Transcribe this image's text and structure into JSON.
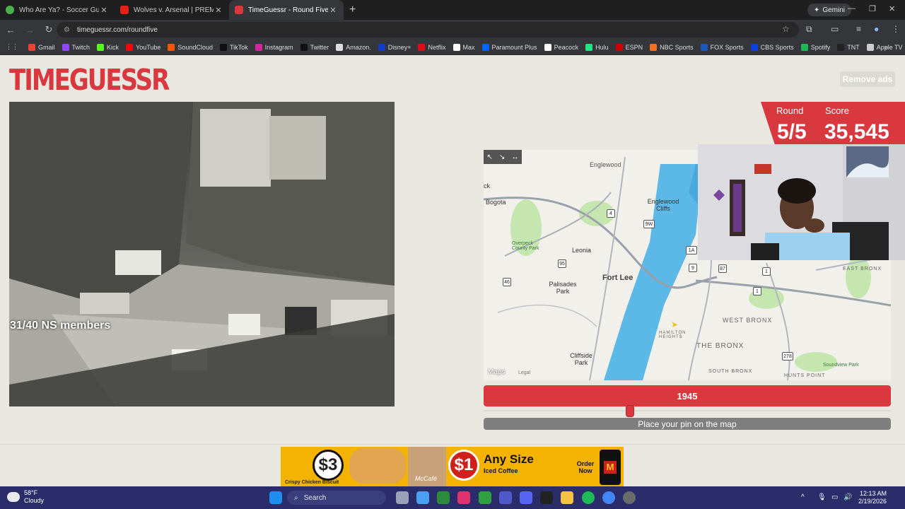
{
  "browser": {
    "tabs": [
      {
        "label": "Who Are Ya? - Soccer Guesser",
        "icon": "soccer-icon",
        "color": "#4caf50"
      },
      {
        "label": "Wolves v. Arsenal | PREMIER LE",
        "icon": "youtube-icon",
        "color": "#e62117"
      },
      {
        "label": "TimeGuessr - Round Five",
        "icon": "timeguessr-icon",
        "color": "#d9383f",
        "active": true
      }
    ],
    "new_tab": "+",
    "gemini_label": "Gemini",
    "url": "timeguessr.com/roundfive",
    "bookmarks": [
      {
        "label": "Gmail",
        "color": "#ea4335"
      },
      {
        "label": "Twitch",
        "color": "#9146ff"
      },
      {
        "label": "Kick",
        "color": "#53fc18"
      },
      {
        "label": "YouTube",
        "color": "#ff0000"
      },
      {
        "label": "SoundCloud",
        "color": "#ff5500"
      },
      {
        "label": "TikTok",
        "color": "#111111"
      },
      {
        "label": "Instagram",
        "color": "#d6249f"
      },
      {
        "label": "Twitter",
        "color": "#111111"
      },
      {
        "label": "Amazon.",
        "color": "#dddddd"
      },
      {
        "label": "Disney+",
        "color": "#113ccf"
      },
      {
        "label": "Netflix",
        "color": "#e50914"
      },
      {
        "label": "Max",
        "color": "#ffffff"
      },
      {
        "label": "Paramount Plus",
        "color": "#0064ff"
      },
      {
        "label": "Peacock",
        "color": "#ffffff"
      },
      {
        "label": "Hulu",
        "color": "#1ce783"
      },
      {
        "label": "ESPN",
        "color": "#d00000"
      },
      {
        "label": "NBC Sports",
        "color": "#f37021"
      },
      {
        "label": "FOX Sports",
        "color": "#1a57c1"
      },
      {
        "label": "CBS Sports",
        "color": "#0b3fe0"
      },
      {
        "label": "Spotify",
        "color": "#1db954"
      },
      {
        "label": "TNT",
        "color": "#222222"
      },
      {
        "label": "Apple TV",
        "color": "#cccccc"
      }
    ]
  },
  "page": {
    "logo": "TIMEGUESSR",
    "remove_ads": "Remove ads",
    "overlay_text": "31/40 NS members",
    "round_label": "Round",
    "round_value": "5/5",
    "score_label": "Score",
    "score_value": "35,545",
    "year": "1945",
    "year_fraction": 0.36,
    "place_pin": "Place your pin on the map",
    "accent_color": "#d9383f"
  },
  "map": {
    "labels": {
      "bogota": "Bogota",
      "englewood": "Englewood Cliffs",
      "overpeck": "Overpeck County Park",
      "leonia": "Leonia",
      "fort_lee": "Fort Lee",
      "palisades": "Palisades Park",
      "cliffside": "Cliffside Park",
      "west_bronx": "WEST BRONX",
      "the_bronx": "THE BRONX",
      "south_bronx": "SOUTH BRONX",
      "east_bronx": "EAST BRONX",
      "hamilton": "HAMILTON HEIGHTS",
      "soundview": "Soundview Park",
      "hunts_point": "HUNTS POINT",
      "top_cut": "Englewood",
      "left_cut": "ck"
    },
    "shields": [
      "4",
      "9W",
      "95",
      "1",
      "46",
      "1A",
      "9",
      "87",
      "1",
      "278"
    ],
    "maps_logo": "Maps",
    "legal": "Legal"
  },
  "ad": {
    "price_1": "$3",
    "item_1": "Crispy Chicken Biscuit",
    "price_2": "$1",
    "headline": "Any Size",
    "sub": "Iced Coffee",
    "cta": "Order Now",
    "brand_text": "McCafé"
  },
  "taskbar": {
    "temp": "58°F",
    "condition": "Cloudy",
    "search": "Search",
    "time": "12:13 AM",
    "date": "2/19/2026"
  }
}
